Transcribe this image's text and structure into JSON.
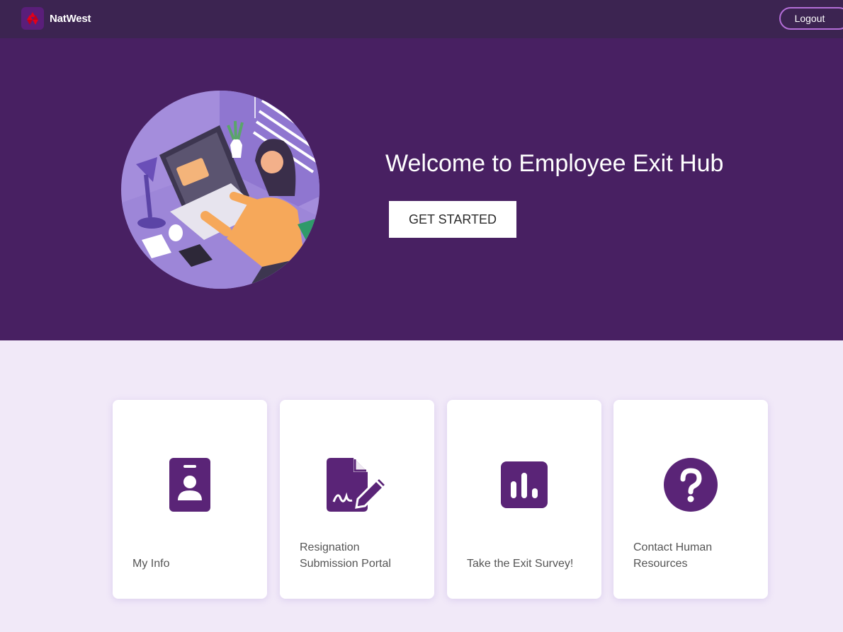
{
  "header": {
    "brand_name": "NatWest",
    "logout_label": "Logout"
  },
  "hero": {
    "title": "Welcome to Employee Exit Hub",
    "cta_label": "GET STARTED"
  },
  "cards": [
    {
      "label": "My Info",
      "icon": "id-badge-icon"
    },
    {
      "label": "Resignation Submission Portal",
      "icon": "signed-document-icon"
    },
    {
      "label": "Take the Exit Survey!",
      "icon": "bar-chart-icon"
    },
    {
      "label": "Contact Human Resources",
      "icon": "question-circle-icon"
    }
  ],
  "colors": {
    "header_bg": "#3c2451",
    "hero_bg": "#482062",
    "accent": "#5a2477",
    "page_bg": "#f1e9f8"
  }
}
